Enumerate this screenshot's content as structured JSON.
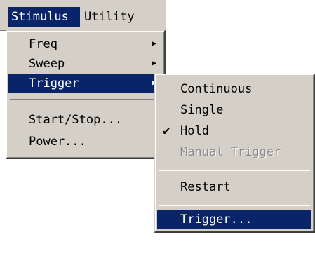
{
  "menubar": {
    "stimulus": "Stimulus",
    "utility": "Utility"
  },
  "main_menu": {
    "items": [
      {
        "label": "Freq",
        "arrow": "▶"
      },
      {
        "label": "Sweep",
        "arrow": "▶"
      },
      {
        "label": "Trigger",
        "arrow": "▶"
      },
      {
        "label": "Start/Stop..."
      },
      {
        "label": "Power..."
      }
    ]
  },
  "trigger_submenu": {
    "items": [
      {
        "label": "Continuous"
      },
      {
        "label": "Single"
      },
      {
        "label": "Hold",
        "check": "✔"
      },
      {
        "label": "Manual Trigger",
        "state": "disabled"
      },
      {
        "label": "Restart"
      },
      {
        "label": "Trigger..."
      }
    ]
  },
  "colors": {
    "menu_bg": "#d4d0c8",
    "highlight": "#0a246a",
    "disabled_text": "#8c8c8c"
  }
}
